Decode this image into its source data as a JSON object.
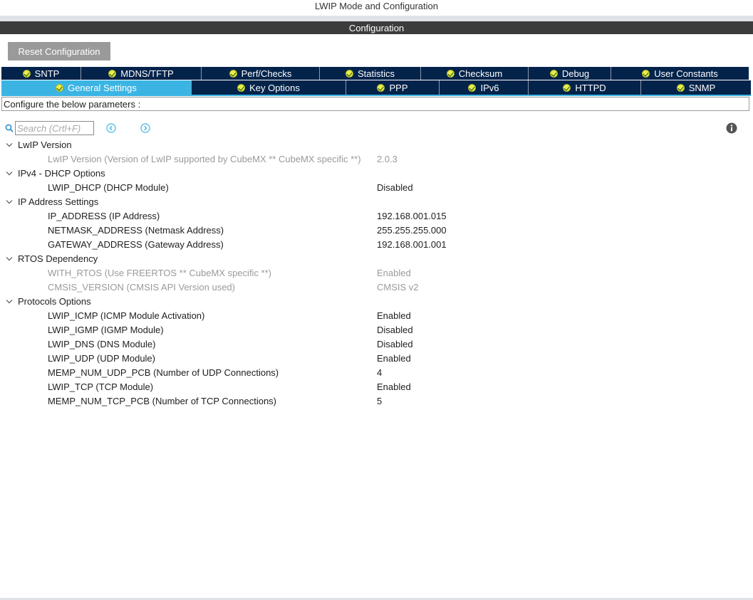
{
  "window": {
    "title": "LWIP Mode and Configuration"
  },
  "config_header": "Configuration",
  "reset_button": "Reset Configuration",
  "tabs_row1": [
    "SNTP",
    "MDNS/TFTP",
    "Perf/Checks",
    "Statistics",
    "Checksum",
    "Debug",
    "User Constants"
  ],
  "tabs_row2": [
    "General Settings",
    "Key Options",
    "PPP",
    "IPv6",
    "HTTPD",
    "SNMP"
  ],
  "active_tab": "General Settings",
  "description": "Configure the below parameters :",
  "search": {
    "placeholder": "Search (Crtl+F)"
  },
  "groups": [
    {
      "title": "LwIP Version",
      "params": [
        {
          "label": "LwIP Version (Version of LwIP supported by CubeMX ** CubeMX specific **)",
          "value": "2.0.3",
          "disabled": true
        }
      ]
    },
    {
      "title": "IPv4 - DHCP Options",
      "params": [
        {
          "label": "LWIP_DHCP (DHCP Module)",
          "value": "Disabled",
          "disabled": false
        }
      ]
    },
    {
      "title": "IP Address Settings",
      "params": [
        {
          "label": "IP_ADDRESS (IP Address)",
          "value": "192.168.001.015",
          "disabled": false
        },
        {
          "label": "NETMASK_ADDRESS (Netmask Address)",
          "value": "255.255.255.000",
          "disabled": false
        },
        {
          "label": "GATEWAY_ADDRESS (Gateway Address)",
          "value": "192.168.001.001",
          "disabled": false
        }
      ]
    },
    {
      "title": "RTOS Dependency",
      "params": [
        {
          "label": "WITH_RTOS (Use FREERTOS ** CubeMX specific **)",
          "value": "Enabled",
          "disabled": true
        },
        {
          "label": "CMSIS_VERSION (CMSIS API Version used)",
          "value": "CMSIS v2",
          "disabled": true
        }
      ]
    },
    {
      "title": "Protocols Options",
      "params": [
        {
          "label": "LWIP_ICMP (ICMP Module Activation)",
          "value": "Enabled",
          "disabled": false
        },
        {
          "label": "LWIP_IGMP (IGMP Module)",
          "value": "Disabled",
          "disabled": false
        },
        {
          "label": "LWIP_DNS (DNS Module)",
          "value": "Disabled",
          "disabled": false
        },
        {
          "label": "LWIP_UDP (UDP Module)",
          "value": "Enabled",
          "disabled": false
        },
        {
          "label": "MEMP_NUM_UDP_PCB (Number of UDP Connections)",
          "value": "4",
          "disabled": false
        },
        {
          "label": "LWIP_TCP (TCP Module)",
          "value": "Enabled",
          "disabled": false
        },
        {
          "label": "MEMP_NUM_TCP_PCB (Number of TCP Connections)",
          "value": "5",
          "disabled": false
        }
      ]
    }
  ]
}
